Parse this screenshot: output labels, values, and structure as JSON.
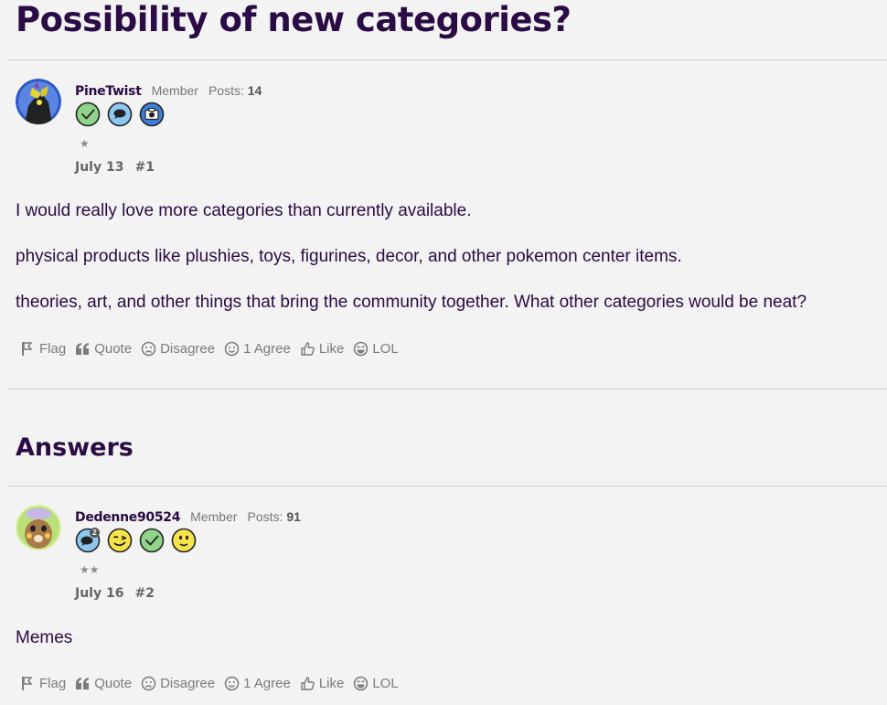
{
  "page": {
    "title": "Possibility of new categories?"
  },
  "post1": {
    "username": "PineTwist",
    "role": "Member",
    "posts_label": "Posts:",
    "posts_count": "14",
    "badges": [
      "check-badge-icon",
      "comment-badge-icon",
      "camera-badge-icon"
    ],
    "stars": "★",
    "date": "July 13",
    "number": "#1",
    "body": [
      "I would really love more categories than currently available.",
      "physical products like plushies, toys, figurines, decor, and other pokemon center items.",
      "theories, art, and other things that bring the community together. What other categories would be neat?"
    ],
    "actions": {
      "flag": "Flag",
      "quote": "Quote",
      "disagree": "Disagree",
      "agree": "1 Agree",
      "like": "Like",
      "lol": "LOL"
    }
  },
  "answers": {
    "title": "Answers"
  },
  "post2": {
    "username": "Dedenne90524",
    "role": "Member",
    "posts_label": "Posts:",
    "posts_count": "91",
    "badge_count": "2",
    "badges": [
      "comment-count-badge-icon",
      "wink-badge-icon",
      "check-badge-icon",
      "smile-badge-icon"
    ],
    "stars": "★★",
    "date": "July 16",
    "number": "#2",
    "body": [
      "Memes"
    ],
    "actions": {
      "flag": "Flag",
      "quote": "Quote",
      "disagree": "Disagree",
      "agree": "1 Agree",
      "like": "Like",
      "lol": "LOL"
    }
  },
  "colors": {
    "title": "#2a0b45",
    "muted": "#777777",
    "divider": "#cfcfcf",
    "badge_green": "#8fd48a",
    "badge_blue": "#8cc7f0",
    "badge_yellow": "#f6e34a"
  }
}
